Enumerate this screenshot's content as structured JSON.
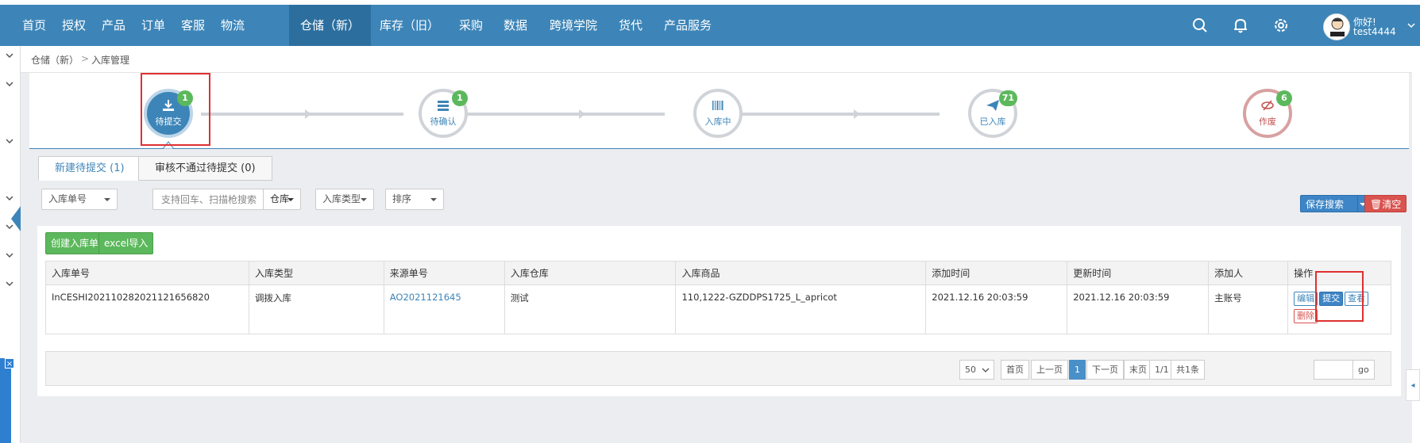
{
  "nav": {
    "items": [
      "首页",
      "授权",
      "产品",
      "订单",
      "客服",
      "物流",
      "仓储（新）",
      "库存（旧）",
      "采购",
      "数据",
      "跨境学院",
      "货代",
      "产品服务"
    ],
    "active_index": 6,
    "icons": [
      "search-icon",
      "bell-icon",
      "gear-icon"
    ],
    "user_hello": "你好!",
    "user_name": "test4444"
  },
  "breadcrumb": {
    "parent": "仓储（新）",
    "sep": ">",
    "current": "入库管理"
  },
  "steps": [
    {
      "label": "待提交",
      "badge": "1",
      "icon": "download-icon",
      "state": "active"
    },
    {
      "label": "待确认",
      "badge": "1",
      "icon": "stack-icon",
      "state": "normal"
    },
    {
      "label": "入库中",
      "badge": "",
      "icon": "barcode-icon",
      "state": "normal"
    },
    {
      "label": "已入库",
      "badge": "71",
      "icon": "paper-plane-icon",
      "state": "normal"
    },
    {
      "label": "作废",
      "badge": "6",
      "icon": "eye-slash-icon",
      "state": "void"
    }
  ],
  "tabs": [
    {
      "label": "新建待提交 (1)",
      "active": true
    },
    {
      "label": "审核不通过待提交 (0)",
      "active": false
    }
  ],
  "filters": {
    "inbound_no": "入库单号",
    "search_placeholder": "支持回车、扫描枪搜索",
    "warehouse": "仓库",
    "inbound_type": "入库类型",
    "sort": "排序",
    "save_search": "保存搜索",
    "clear": "清空"
  },
  "actions": {
    "create": "创建入库单",
    "excel_import": "excel导入"
  },
  "table": {
    "columns": [
      "入库单号",
      "入库类型",
      "来源单号",
      "入库仓库",
      "入库商品",
      "添加时间",
      "更新时间",
      "添加人",
      "操作"
    ],
    "rows": [
      {
        "inbound_no": "InCESHI20211028202112165682​0",
        "type": "调拨入库",
        "source_no": "AO2021121645",
        "warehouse": "测试",
        "goods": "110,1222-GZDDPS1725_L_apricot",
        "added": "2021.12.16 20:03:59",
        "updated": "2021.12.16 20:03:59",
        "adder": "主账号",
        "ops": {
          "edit": "编辑",
          "submit": "提交",
          "view": "查看",
          "delete": "删除"
        }
      }
    ]
  },
  "pager": {
    "page_size": "50",
    "first": "首页",
    "prev": "上一页",
    "current": "1",
    "next": "下一页",
    "last": "末页",
    "position": "1/1",
    "total": "共1条",
    "go": "go"
  },
  "colors": {
    "nav_bg": "#3d85b8",
    "badge": "#5cb85c",
    "highlight": "#e03030"
  }
}
